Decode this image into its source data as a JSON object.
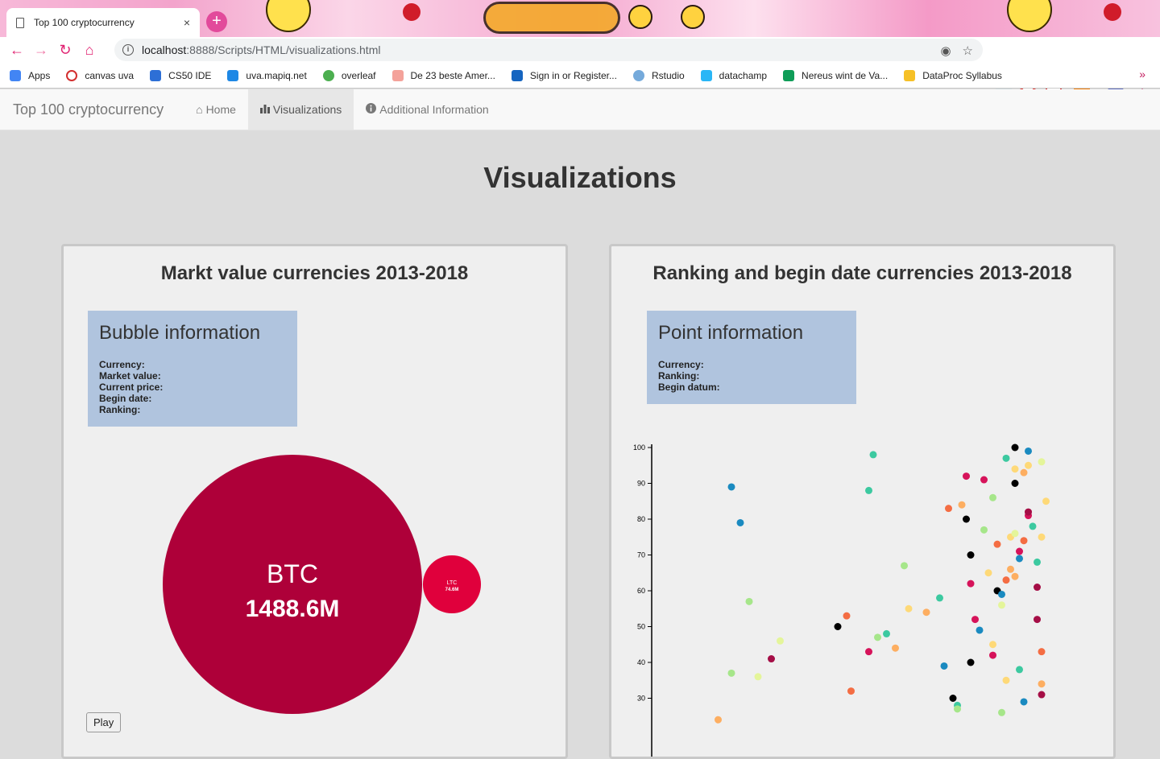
{
  "browser": {
    "tab_title": "Top 100 cryptocurrency",
    "tab_close": "×",
    "new_tab": "+",
    "url_host": "localhost",
    "url_path": ":8888/Scripts/HTML/visualizations.html",
    "bookmarks": [
      {
        "label": "Apps",
        "color": "#4285f4"
      },
      {
        "label": "canvas uva",
        "color": "#d32f2f"
      },
      {
        "label": "CS50 IDE",
        "color": "#2d6fd6"
      },
      {
        "label": "uva.mapiq.net",
        "color": "#1e88e5"
      },
      {
        "label": "overleaf",
        "color": "#4caf50"
      },
      {
        "label": "De 23 beste Amer...",
        "color": "#f4a29a"
      },
      {
        "label": "Sign in or Register...",
        "color": "#1565c0"
      },
      {
        "label": "Rstudio",
        "color": "#75aadb"
      },
      {
        "label": "datachamp",
        "color": "#29b6f6"
      },
      {
        "label": "Nereus wint de Va...",
        "color": "#0f9d58"
      },
      {
        "label": "DataProc Syllabus",
        "color": "#f6c026"
      }
    ],
    "bookmarks_more": "»"
  },
  "navbar": {
    "brand": "Top 100 cryptocurrency",
    "home": "Home",
    "visualizations": "Visualizations",
    "additional": "Additional Information"
  },
  "page": {
    "heading": "Visualizations"
  },
  "left_panel": {
    "title": "Markt value currencies 2013-2018",
    "info_title": "Bubble information",
    "info_rows": [
      "Currency:",
      "Market value:",
      "Current price:",
      "Begin date:",
      "Ranking:"
    ],
    "play_label": "Play"
  },
  "right_panel": {
    "title": "Ranking and begin date currencies 2013-2018",
    "info_title": "Point information",
    "info_rows": [
      "Currency:",
      "Ranking:",
      "Begin datum:"
    ]
  },
  "chart_data": [
    {
      "type": "bubble",
      "title": "Markt value currencies 2013-2018",
      "bubbles": [
        {
          "name": "BTC",
          "value_label": "1488.6M",
          "value": 1488.6,
          "color": "#ae0039"
        },
        {
          "name": "LTC",
          "value_label": "74.6M",
          "value": 74.6,
          "color": "#e0003c"
        }
      ]
    },
    {
      "type": "scatter",
      "title": "Ranking and begin date currencies 2013-2018",
      "ylim": [
        20,
        100
      ],
      "yticks": [
        30,
        40,
        50,
        60,
        70,
        80,
        90,
        100
      ],
      "xlim": [
        0,
        100
      ],
      "colors": [
        "#000000",
        "#1a8ac0",
        "#3cc9a0",
        "#a6e68a",
        "#e4f59a",
        "#fed978",
        "#fdae61",
        "#f46d43",
        "#d6135a",
        "#a50e46"
      ],
      "points": [
        [
          18,
          89,
          1
        ],
        [
          20,
          79,
          1
        ],
        [
          22,
          57,
          3
        ],
        [
          18,
          37,
          3
        ],
        [
          24,
          36,
          4
        ],
        [
          27,
          41,
          9
        ],
        [
          29,
          46,
          4
        ],
        [
          15,
          24,
          6
        ],
        [
          45,
          32,
          7
        ],
        [
          44,
          53,
          7
        ],
        [
          42,
          50,
          0
        ],
        [
          50,
          98,
          2
        ],
        [
          49,
          88,
          2
        ],
        [
          49,
          43,
          8
        ],
        [
          51,
          47,
          3
        ],
        [
          53,
          48,
          2
        ],
        [
          55,
          44,
          6
        ],
        [
          57,
          67,
          3
        ],
        [
          58,
          55,
          5
        ],
        [
          62,
          54,
          6
        ],
        [
          65,
          58,
          2
        ],
        [
          66,
          39,
          1
        ],
        [
          67,
          83,
          7
        ],
        [
          68,
          30,
          0
        ],
        [
          69,
          28,
          2
        ],
        [
          69,
          27,
          3
        ],
        [
          70,
          84,
          6
        ],
        [
          71,
          92,
          8
        ],
        [
          71,
          80,
          0
        ],
        [
          72,
          70,
          0
        ],
        [
          72,
          62,
          8
        ],
        [
          72,
          40,
          0
        ],
        [
          73,
          52,
          8
        ],
        [
          74,
          49,
          1
        ],
        [
          75,
          91,
          8
        ],
        [
          75,
          77,
          3
        ],
        [
          76,
          65,
          5
        ],
        [
          77,
          45,
          5
        ],
        [
          77,
          42,
          8
        ],
        [
          77,
          86,
          3
        ],
        [
          78,
          60,
          0
        ],
        [
          78,
          73,
          7
        ],
        [
          79,
          59,
          1
        ],
        [
          79,
          56,
          4
        ],
        [
          79,
          26,
          3
        ],
        [
          80,
          97,
          2
        ],
        [
          80,
          35,
          5
        ],
        [
          80,
          63,
          7
        ],
        [
          81,
          75,
          5
        ],
        [
          81,
          66,
          6
        ],
        [
          82,
          100,
          0
        ],
        [
          82,
          94,
          5
        ],
        [
          82,
          90,
          0
        ],
        [
          82,
          64,
          6
        ],
        [
          82,
          76,
          4
        ],
        [
          83,
          71,
          8
        ],
        [
          83,
          69,
          1
        ],
        [
          83,
          38,
          2
        ],
        [
          84,
          74,
          7
        ],
        [
          84,
          93,
          6
        ],
        [
          84,
          29,
          1
        ],
        [
          85,
          99,
          1
        ],
        [
          85,
          95,
          5
        ],
        [
          85,
          81,
          8
        ],
        [
          85,
          82,
          9
        ],
        [
          86,
          78,
          2
        ],
        [
          87,
          68,
          2
        ],
        [
          87,
          61,
          9
        ],
        [
          87,
          52,
          9
        ],
        [
          88,
          75,
          5
        ],
        [
          88,
          96,
          4
        ],
        [
          88,
          43,
          7
        ],
        [
          88,
          34,
          6
        ],
        [
          88,
          31,
          9
        ],
        [
          89,
          85,
          5
        ]
      ]
    }
  ]
}
